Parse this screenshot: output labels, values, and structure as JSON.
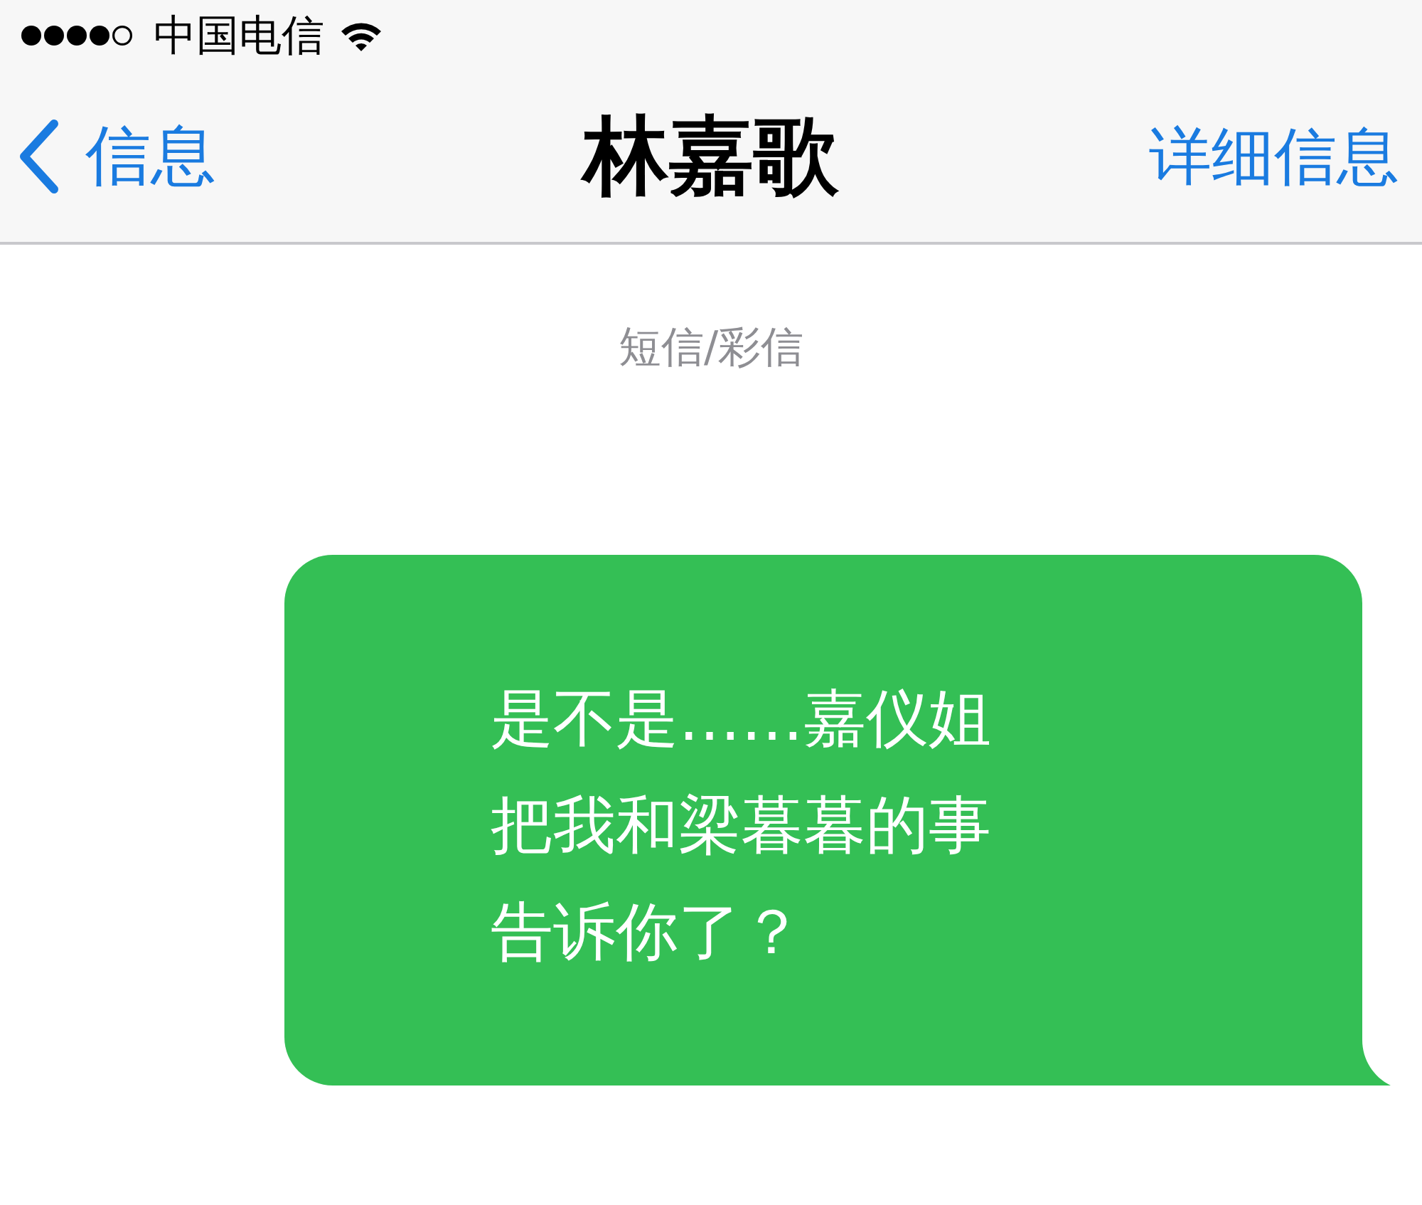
{
  "status_bar": {
    "carrier": "中国电信"
  },
  "nav_bar": {
    "back_label": "信息",
    "title": "林嘉歌",
    "action": "详细信息"
  },
  "thread": {
    "service_label": "短信/彩信",
    "messages": [
      {
        "kind": "sent",
        "lines": [
          "是不是……嘉仪姐",
          "把我和梁暮暮的事",
          "告诉你了？"
        ]
      }
    ]
  }
}
